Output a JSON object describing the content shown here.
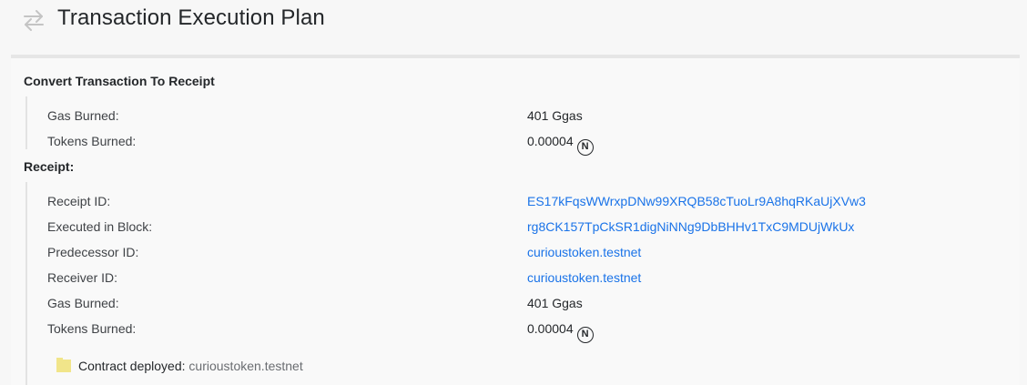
{
  "header": {
    "title": "Transaction Execution Plan",
    "icon": "transfer-arrows-icon"
  },
  "convert_section": {
    "title": "Convert Transaction To Receipt",
    "rows": [
      {
        "label": "Gas Burned:",
        "value": "401 Ggas"
      },
      {
        "label": "Tokens Burned:",
        "value": "0.00004",
        "badge": "N"
      }
    ]
  },
  "receipt_section": {
    "title": "Receipt:",
    "rows": [
      {
        "label": "Receipt ID:",
        "value": "ES17kFqsWWrxpDNw99XRQB58cTuoLr9A8hqRKaUjXVw3"
      },
      {
        "label": "Executed in Block:",
        "value": "rg8CK157TpCkSR1digNiNNg9DbBHHv1TxC9MDUjWkUx"
      },
      {
        "label": "Predecessor ID:",
        "value": "curioustoken.testnet"
      },
      {
        "label": "Receiver ID:",
        "value": "curioustoken.testnet"
      },
      {
        "label": "Gas Burned:",
        "value": "401 Ggas"
      },
      {
        "label": "Tokens Burned:",
        "value": "0.00004",
        "badge": "N"
      }
    ],
    "action": {
      "label": "Contract deployed:",
      "value": "curioustoken.testnet",
      "icon": "folder-icon"
    }
  },
  "colors": {
    "link": "#1a73e8",
    "text": "#24272a",
    "background": "#f7f7f7"
  }
}
